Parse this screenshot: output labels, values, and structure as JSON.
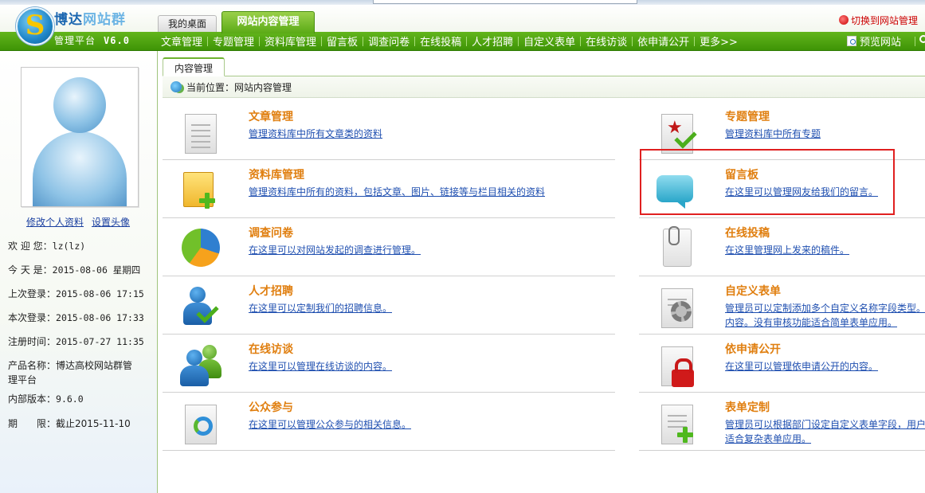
{
  "header": {
    "logo_title_main": "博达",
    "logo_title_accent": "网站群",
    "logo_sub": "管理平台",
    "version": "V6.0",
    "tab_desktop": "我的桌面",
    "tab_content": "网站内容管理",
    "switch_link": "切换到网站管理"
  },
  "nav": {
    "items": [
      "文章管理",
      "专题管理",
      "资料库管理",
      "留言板",
      "调查问卷",
      "在线投稿",
      "人才招聘",
      "自定义表单",
      "在线访谈",
      "依申请公开",
      "更多>>"
    ],
    "preview": "预览网站"
  },
  "sidebar": {
    "edit_profile": "修改个人资料",
    "set_avatar": "设置头像",
    "info": [
      {
        "k": "欢 迎 您：",
        "v": "lz(lz)"
      },
      {
        "k": "今 天 是：",
        "v": "2015-08-06 星期四"
      },
      {
        "k": "上次登录：",
        "v": "2015-08-06 17:15"
      },
      {
        "k": "本次登录：",
        "v": "2015-08-06 17:33"
      },
      {
        "k": "注册时间：",
        "v": "2015-07-27 11:35"
      },
      {
        "k": "产品名称：",
        "v": "博达高校网站群管理平台"
      },
      {
        "k": "内部版本：",
        "v": "9.6.0"
      },
      {
        "k": "期　　限：",
        "v": "截止2015-11-10"
      }
    ]
  },
  "main": {
    "content_tab": "内容管理",
    "breadcrumb": "当前位置：网站内容管理",
    "cards": [
      {
        "title": "文章管理",
        "desc": "管理资料库中所有文章类的资料"
      },
      {
        "title": "专题管理",
        "desc": "管理资料库中所有专题"
      },
      {
        "title": "资料库管理",
        "desc": "管理资料库中所有的资料，包括文章、图片、链接等与栏目相关的资料"
      },
      {
        "title": "留言板",
        "desc": "在这里可以管理网友给我们的留言。"
      },
      {
        "title": "调查问卷",
        "desc": "在这里可以对网站发起的调查进行管理。"
      },
      {
        "title": "在线投稿",
        "desc": "在这里管理网上发来的稿件。"
      },
      {
        "title": "人才招聘",
        "desc": "在这里可以定制我们的招聘信息。"
      },
      {
        "title": "自定义表单",
        "desc": "管理员可以定制添加多个自定义名称字段类型。",
        "desc2": "内容。没有审核功能适合简单表单应用。"
      },
      {
        "title": "在线访谈",
        "desc": "在这里可以管理在线访谈的内容。"
      },
      {
        "title": "依申请公开",
        "desc": "在这里可以管理依申请公开的内容。"
      },
      {
        "title": "公众参与",
        "desc": "在这里可以管理公众参与的相关信息。"
      },
      {
        "title": "表单定制",
        "desc": "管理员可以根据部门设定自定义表单字段，用户",
        "desc2": "适合复杂表单应用。"
      }
    ]
  }
}
